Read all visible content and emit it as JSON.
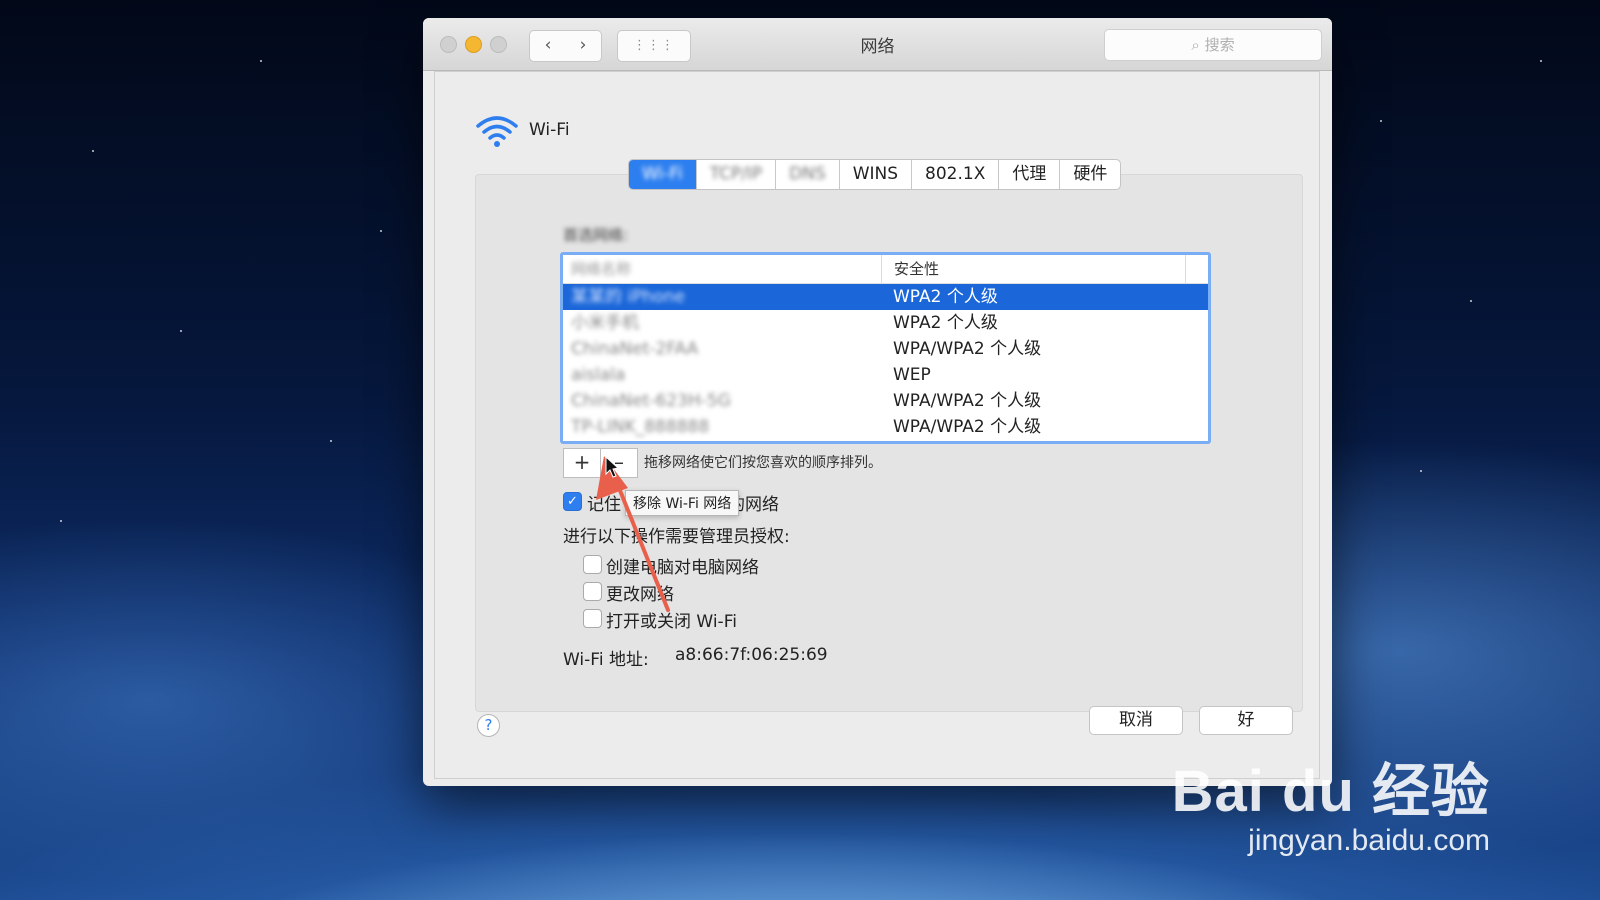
{
  "window": {
    "title": "网络",
    "search_placeholder": "搜索",
    "nav_back": "‹",
    "nav_forward": "›",
    "grid_icon": "⋮⋮⋮"
  },
  "interface": {
    "name": "Wi-Fi",
    "icon": "wifi-icon"
  },
  "tabs": [
    {
      "label": "Wi-Fi",
      "active": true,
      "blurred": true
    },
    {
      "label": "TCP/IP",
      "active": false,
      "blurred": true
    },
    {
      "label": "DNS",
      "active": false,
      "blurred": true
    },
    {
      "label": "WINS",
      "active": false,
      "blurred": false
    },
    {
      "label": "802.1X",
      "active": false,
      "blurred": false
    },
    {
      "label": "代理",
      "active": false,
      "blurred": false
    },
    {
      "label": "硬件",
      "active": false,
      "blurred": false
    }
  ],
  "preferred": {
    "label": "首选网络:",
    "columns": [
      "网络名称",
      "安全性"
    ],
    "rows": [
      {
        "name": "某某的 iPhone",
        "security": "WPA2 个人级",
        "selected": true
      },
      {
        "name": "小米手机",
        "security": "WPA2 个人级",
        "selected": false
      },
      {
        "name": "ChinaNet-2FAA",
        "security": "WPA/WPA2 个人级",
        "selected": false
      },
      {
        "name": "aislala",
        "security": "WEP",
        "selected": false
      },
      {
        "name": "ChinaNet-623H-5G",
        "security": "WPA/WPA2 个人级",
        "selected": false
      },
      {
        "name": "TP-LINK_888888",
        "security": "WPA/WPA2 个人级",
        "selected": false
      }
    ],
    "add_label": "+",
    "remove_label": "–",
    "drag_hint": "拖移网络使它们按您喜欢的顺序排列。",
    "tooltip": "移除 Wi-Fi 网络"
  },
  "options": {
    "remember_label": "记住",
    "remember_suffix": "的网络",
    "remember_checked": true,
    "admin_heading": "进行以下操作需要管理员授权:",
    "admin_items": [
      {
        "label": "创建电脑对电脑网络",
        "checked": false
      },
      {
        "label": "更改网络",
        "checked": false
      },
      {
        "label": "打开或关闭 Wi-Fi",
        "checked": false
      }
    ],
    "address_label": "Wi-Fi 地址:",
    "address_value": "a8:66:7f:06:25:69"
  },
  "footer": {
    "help": "?",
    "cancel": "取消",
    "ok": "好"
  },
  "watermark": {
    "logo": "Bai du 经验",
    "url": "jingyan.baidu.com"
  },
  "colors": {
    "accent": "#2d7ff0",
    "selection": "#1b67d9",
    "arrow": "#e8604c"
  }
}
